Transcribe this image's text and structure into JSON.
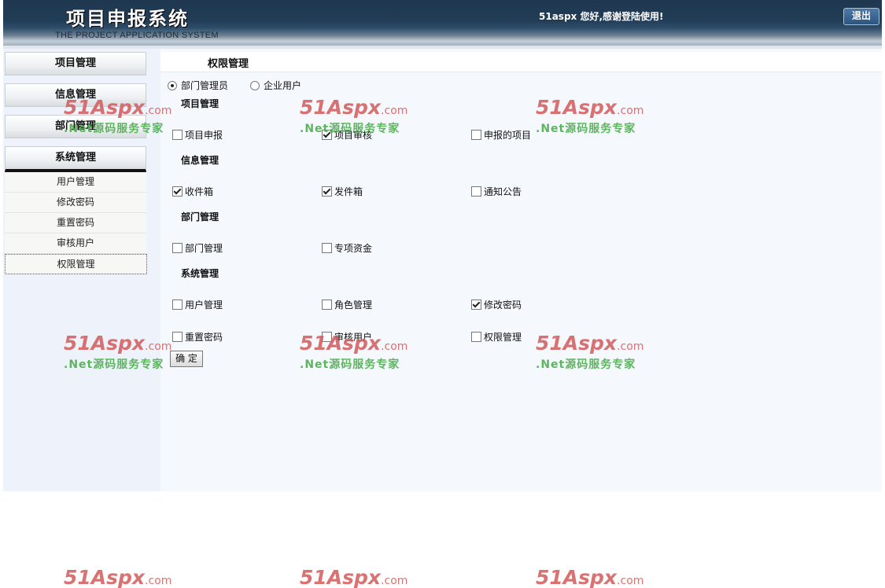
{
  "header": {
    "title": "项目申报系统",
    "subtitle": "THE PROJECT APPLICATION SYSTEM",
    "welcome": "51aspx 您好,感谢登陆使用!",
    "logout_label": "退出"
  },
  "sidebar": {
    "groups": [
      {
        "label": "项目管理"
      },
      {
        "label": "信息管理"
      },
      {
        "label": "部门管理"
      },
      {
        "label": "系统管理"
      }
    ],
    "sub_items": [
      {
        "label": "用户管理"
      },
      {
        "label": "修改密码"
      },
      {
        "label": "重置密码"
      },
      {
        "label": "审核用户"
      },
      {
        "label": "权限管理"
      }
    ]
  },
  "main": {
    "title": "权限管理",
    "role_options": [
      {
        "label": "部门管理员",
        "selected": true
      },
      {
        "label": "企业用户",
        "selected": false
      }
    ],
    "sections": [
      {
        "title": "项目管理",
        "items": [
          {
            "label": "项目申报",
            "checked": false
          },
          {
            "label": "项目审核",
            "checked": true
          },
          {
            "label": "申报的项目",
            "checked": false
          }
        ]
      },
      {
        "title": "信息管理",
        "items": [
          {
            "label": "收件箱",
            "checked": true
          },
          {
            "label": "发件箱",
            "checked": true
          },
          {
            "label": "通知公告",
            "checked": false
          }
        ]
      },
      {
        "title": "部门管理",
        "items": [
          {
            "label": "部门管理",
            "checked": false
          },
          {
            "label": "专项资金",
            "checked": false
          }
        ]
      },
      {
        "title": "系统管理",
        "items": [
          {
            "label": "用户管理",
            "checked": false
          },
          {
            "label": "角色管理",
            "checked": false
          },
          {
            "label": "修改密码",
            "checked": true
          },
          {
            "label": "重置密码",
            "checked": false
          },
          {
            "label": "审核用户",
            "checked": false
          },
          {
            "label": "权限管理",
            "checked": false
          }
        ]
      }
    ],
    "confirm_label": "确 定"
  },
  "watermark": {
    "brand": "51Aspx",
    "suffix": ".com",
    "slogan": ".Net源码服务专家"
  }
}
